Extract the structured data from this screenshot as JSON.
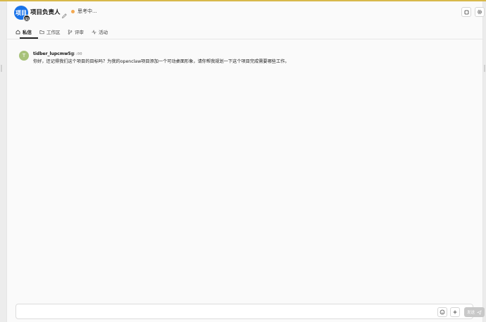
{
  "header": {
    "avatar_text": "项目",
    "title": "项目负责人",
    "status": "思考中..."
  },
  "tabs": [
    {
      "label": "私信",
      "icon": "home-icon",
      "active": true
    },
    {
      "label": "工作区",
      "icon": "folder-icon",
      "active": false
    },
    {
      "label": "评审",
      "icon": "git-branch-icon",
      "active": false
    },
    {
      "label": "活动",
      "icon": "activity-icon",
      "active": false
    }
  ],
  "message": {
    "avatar_letter": "T",
    "user": "tidber_lupcmw5g",
    "time": "15:00",
    "text": "你好，还记得我们这个项目的目标吗？为我的openclaw项目添加一个可动桌面形象，请你帮我规划一下这个项目完成需要哪些工作。"
  },
  "composer": {
    "placeholder": "",
    "send_label": "发送"
  },
  "colors": {
    "accent_top": "#d8b84a",
    "avatar_blue": "#1a73e8",
    "status_dot": "#f3a952",
    "user_avatar": "#a8c27a"
  }
}
